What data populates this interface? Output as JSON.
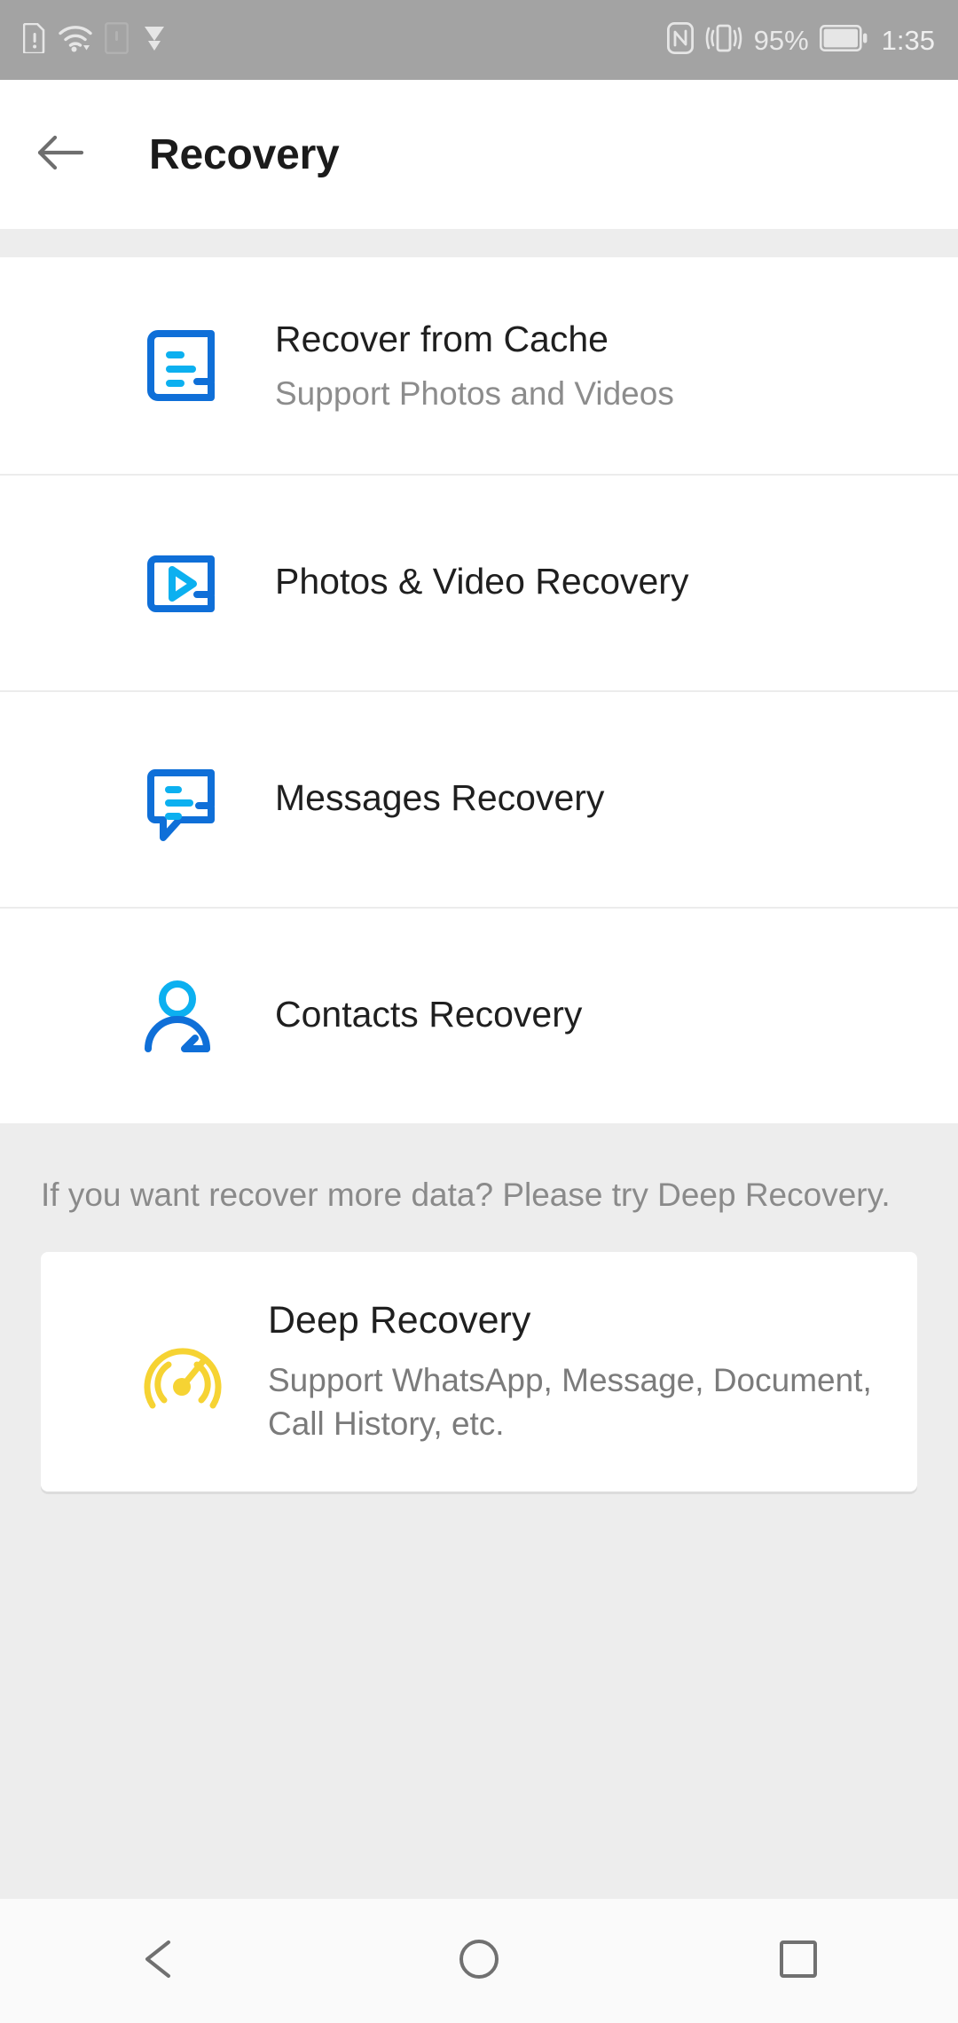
{
  "statusbar": {
    "left_icons": [
      "sim-alert-icon",
      "wifi-icon",
      "sd-card-icon",
      "play-store-icon"
    ],
    "right_icons": [
      "nfc-icon",
      "vibrate-icon",
      "battery-icon"
    ],
    "battery_percent": "95%",
    "clock": "1:35"
  },
  "appbar": {
    "back_icon": "back-arrow-icon",
    "title": "Recovery"
  },
  "list": {
    "items": [
      {
        "icon": "document-recovery-icon",
        "title": "Recover from Cache",
        "subtitle": "Support Photos and Videos"
      },
      {
        "icon": "video-recovery-icon",
        "title": "Photos & Video Recovery",
        "subtitle": ""
      },
      {
        "icon": "message-recovery-icon",
        "title": "Messages Recovery",
        "subtitle": ""
      },
      {
        "icon": "contact-recovery-icon",
        "title": "Contacts Recovery",
        "subtitle": ""
      }
    ]
  },
  "promo": {
    "note": "If you want recover more data? Please try Deep Recovery.",
    "card": {
      "icon": "deep-recovery-gauge-icon",
      "title": "Deep Recovery",
      "subtitle": "Support WhatsApp, Message, Document, Call History, etc."
    }
  },
  "navbar": {
    "back_icon": "nav-back-triangle-icon",
    "home_icon": "nav-home-circle-icon",
    "recents_icon": "nav-recents-square-icon"
  },
  "colors": {
    "accent_blue": "#0f6fd8",
    "accent_cyan": "#0cb0f0",
    "accent_yellow": "#f6d333",
    "statusbar_bg": "#a3a3a3",
    "page_bg": "#ededed",
    "surface": "#ffffff",
    "title_text": "#1f1f1f",
    "sub_text": "#8c8c8c"
  }
}
